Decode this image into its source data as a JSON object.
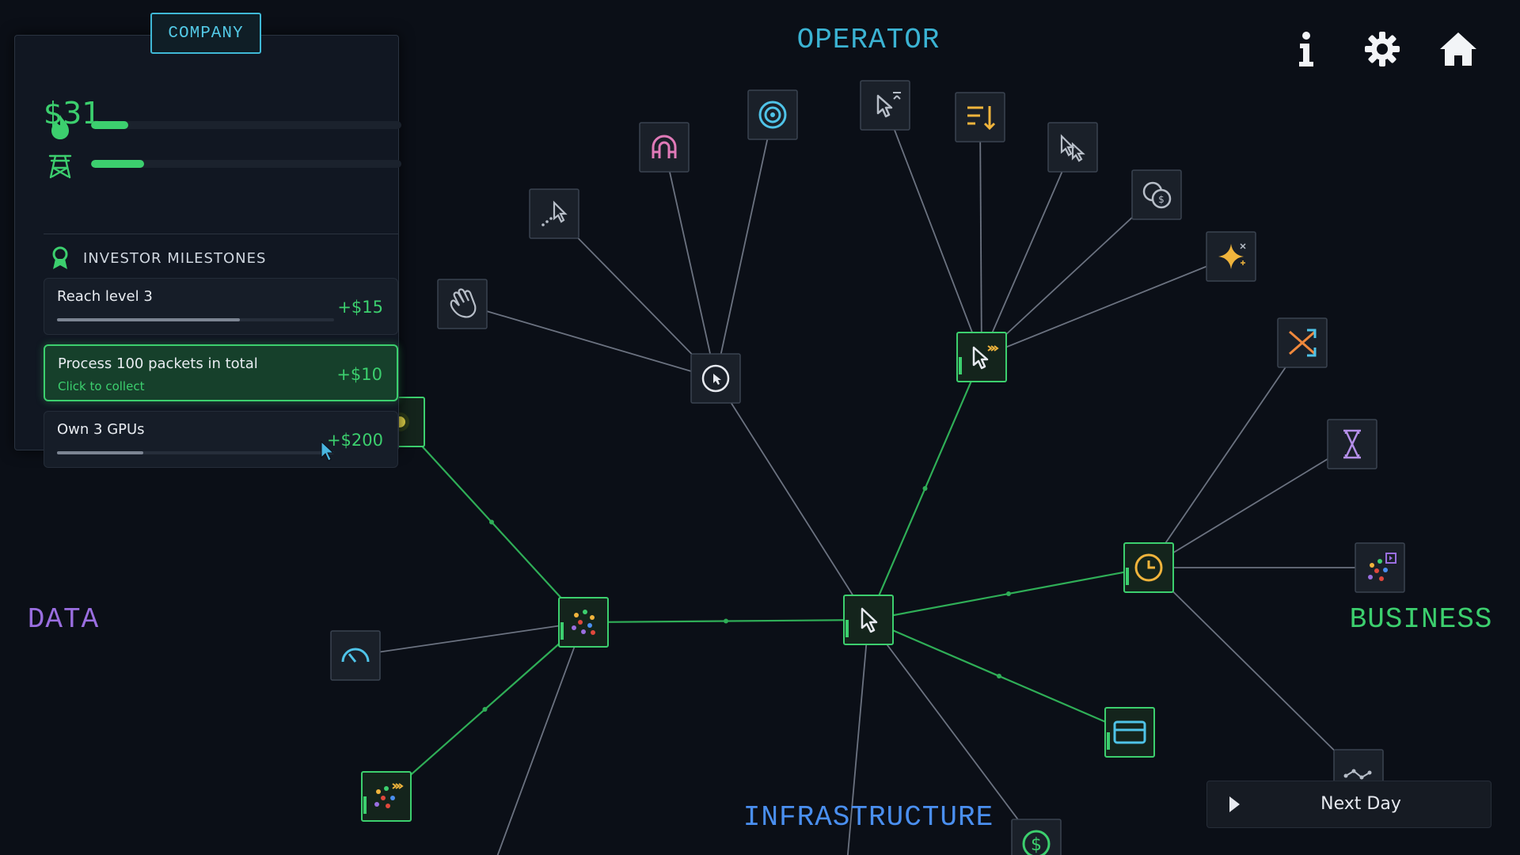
{
  "sections": {
    "operator": "OPERATOR",
    "data": "DATA",
    "business": "BUSINESS",
    "infrastructure": "INFRASTRUCTURE"
  },
  "colors": {
    "operator": "#3bb3d3",
    "data": "#9a6ee0",
    "business": "#3ccf6e",
    "infrastructure": "#4a8ff0",
    "unlocked_edge": "#2fae57",
    "locked_edge": "#6b7280",
    "money": "#3ccf6e"
  },
  "top_icons": [
    "info-icon",
    "gear-icon",
    "home-icon"
  ],
  "panel": {
    "tab": "COMPANY",
    "money": "$31",
    "stats": [
      {
        "icon": "flame-icon",
        "value": 0.12
      },
      {
        "icon": "tower-icon",
        "value": 0.17
      }
    ],
    "milestones_title": "INVESTOR MILESTONES",
    "milestones": [
      {
        "title": "Reach level 3",
        "reward": "+$15",
        "progress": 0.66,
        "active": false
      },
      {
        "title": "Process 100 packets in total",
        "subtitle": "Click to collect",
        "reward": "+$10",
        "active": true
      },
      {
        "title": "Own 3 GPUs",
        "reward": "+$200",
        "progress": 0.31,
        "active": false
      }
    ]
  },
  "nodes": [
    {
      "id": "core",
      "icon": "cursor-icon",
      "unlocked": true
    },
    {
      "id": "op-hub",
      "icon": "cursor-speed-icon",
      "unlocked": true
    },
    {
      "id": "op-timer",
      "icon": "clock-cursor-icon",
      "unlocked": false
    },
    {
      "id": "op-magnet",
      "icon": "magnet-icon",
      "unlocked": false
    },
    {
      "id": "op-target",
      "icon": "target-icon",
      "unlocked": false
    },
    {
      "id": "op-cursor-top",
      "icon": "cursor-up-icon",
      "unlocked": false
    },
    {
      "id": "op-sort",
      "icon": "sort-down-icon",
      "unlocked": false
    },
    {
      "id": "op-multi-cursor",
      "icon": "multi-cursor-icon",
      "unlocked": false
    },
    {
      "id": "op-coins",
      "icon": "coins-icon",
      "unlocked": false
    },
    {
      "id": "op-sparkle",
      "icon": "sparkle-icon",
      "unlocked": false
    },
    {
      "id": "op-trail",
      "icon": "cursor-trail-icon",
      "unlocked": false
    },
    {
      "id": "op-hand",
      "icon": "hand-icon",
      "unlocked": false
    },
    {
      "id": "data-hub",
      "icon": "packets-icon",
      "unlocked": true
    },
    {
      "id": "data-gauge",
      "icon": "gauge-icon",
      "unlocked": false
    },
    {
      "id": "data-packets-fast",
      "icon": "packets-fast-icon",
      "unlocked": true
    },
    {
      "id": "data-top",
      "icon": "data-node-icon",
      "unlocked": true
    },
    {
      "id": "biz-clock",
      "icon": "clock-icon",
      "unlocked": true
    },
    {
      "id": "biz-shuffle",
      "icon": "shuffle-icon",
      "unlocked": false
    },
    {
      "id": "biz-hourglass",
      "icon": "hourglass-icon",
      "unlocked": false
    },
    {
      "id": "biz-packets",
      "icon": "packets-plus-icon",
      "unlocked": false
    },
    {
      "id": "biz-graph",
      "icon": "graph-icon",
      "unlocked": false
    },
    {
      "id": "biz-card",
      "icon": "card-icon",
      "unlocked": true
    },
    {
      "id": "infra-coin",
      "icon": "dollar-icon",
      "unlocked": false
    }
  ],
  "edges": [
    [
      "core",
      "op-hub",
      true
    ],
    [
      "core",
      "op-timer",
      false
    ],
    [
      "core",
      "data-hub",
      true
    ],
    [
      "core",
      "biz-clock",
      true
    ],
    [
      "core",
      "biz-card",
      true
    ],
    [
      "core",
      "infra-coin",
      false
    ],
    [
      "core",
      "infra-down",
      false
    ],
    [
      "op-hub",
      "op-cursor-top",
      false
    ],
    [
      "op-hub",
      "op-sort",
      false
    ],
    [
      "op-hub",
      "op-multi-cursor",
      false
    ],
    [
      "op-hub",
      "op-coins",
      false
    ],
    [
      "op-hub",
      "op-sparkle",
      false
    ],
    [
      "op-timer",
      "op-magnet",
      false
    ],
    [
      "op-timer",
      "op-target",
      false
    ],
    [
      "op-timer",
      "op-trail",
      false
    ],
    [
      "op-timer",
      "op-hand",
      false
    ],
    [
      "data-hub",
      "data-top",
      true
    ],
    [
      "data-hub",
      "data-gauge",
      false
    ],
    [
      "data-hub",
      "data-packets-fast",
      true
    ],
    [
      "data-hub",
      "data-down",
      false
    ],
    [
      "biz-clock",
      "biz-shuffle",
      false
    ],
    [
      "biz-clock",
      "biz-hourglass",
      false
    ],
    [
      "biz-clock",
      "biz-packets",
      false
    ],
    [
      "biz-clock",
      "biz-graph",
      false
    ]
  ],
  "next_day": "Next Day"
}
